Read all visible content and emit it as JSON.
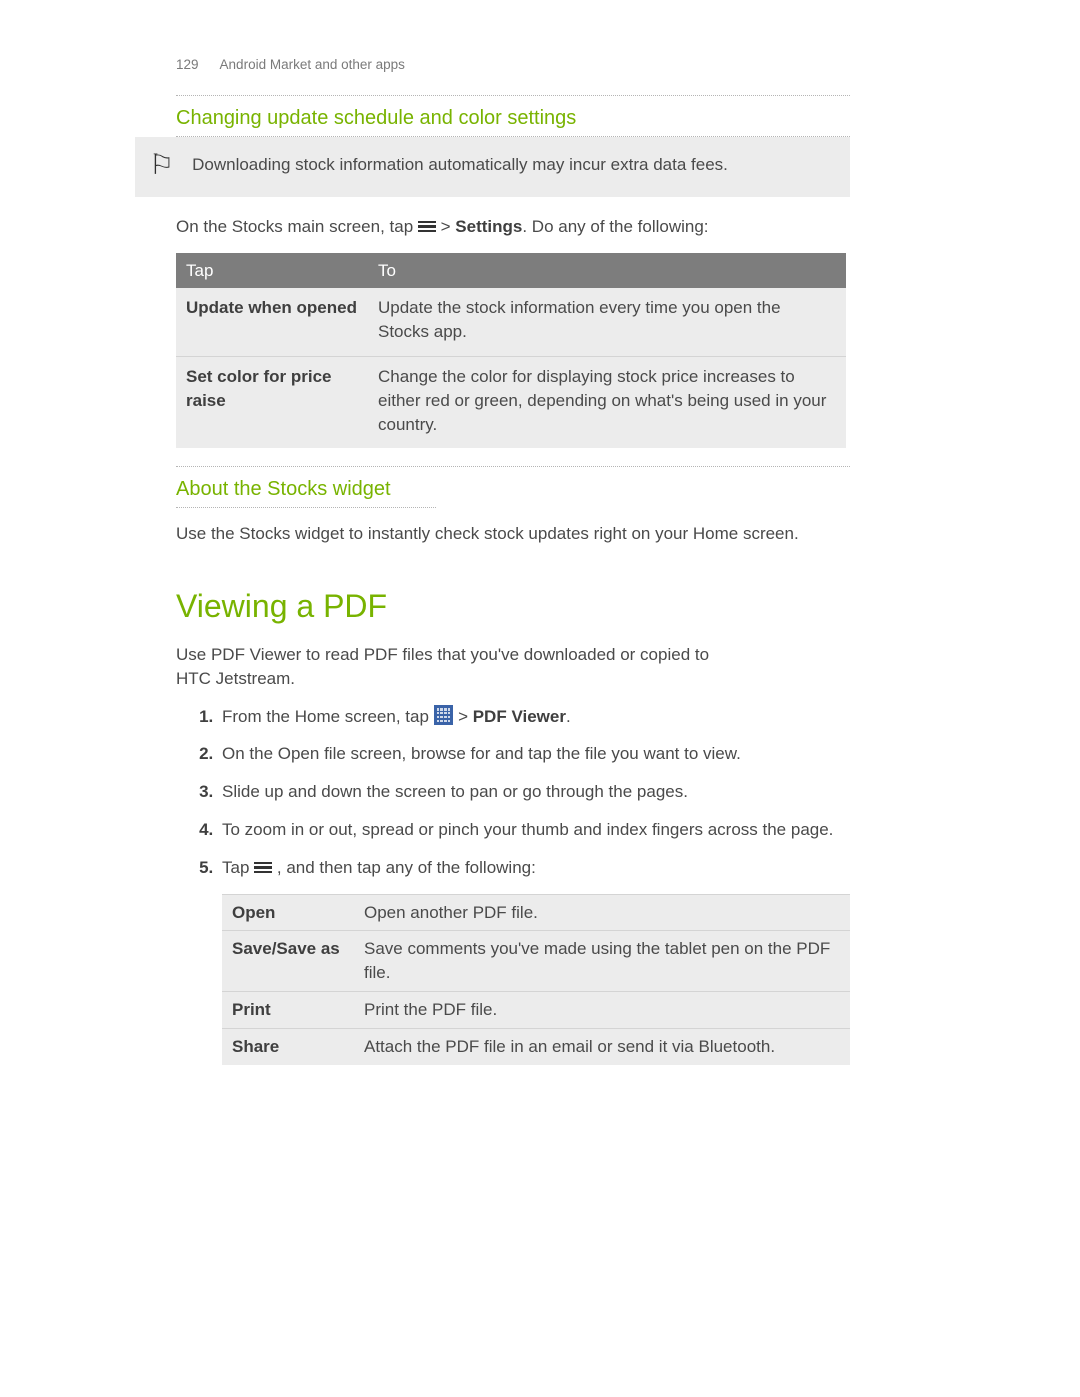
{
  "header": {
    "page_number": "129",
    "breadcrumb": "Android Market and other apps"
  },
  "section1": {
    "title": "Changing update schedule and color settings",
    "callout": "Downloading stock information automatically may incur extra data fees.",
    "intro_pre": "On the Stocks main screen, tap ",
    "intro_mid": " > ",
    "intro_bold": "Settings",
    "intro_post": ". Do any of the following:",
    "table": {
      "head": {
        "c1": "Tap",
        "c2": "To"
      },
      "rows": [
        {
          "c1": "Update when opened",
          "c2": "Update the stock information every time you open the Stocks app."
        },
        {
          "c1": "Set color for price raise",
          "c2": "Change the color for displaying stock price increases to either red or green, depending on what's being used in your country."
        }
      ]
    }
  },
  "section2": {
    "title": "About the Stocks widget",
    "para": "Use the Stocks widget to instantly check stock updates right on your Home screen."
  },
  "section3": {
    "title": "Viewing a PDF",
    "intro": "Use PDF Viewer to read PDF files that you've downloaded or copied to HTC Jetstream.",
    "steps": {
      "s1_pre": "From the Home screen, tap ",
      "s1_mid": " > ",
      "s1_bold": "PDF Viewer",
      "s1_post": ".",
      "s2": "On the Open file screen, browse for and tap the file you want to view.",
      "s3": "Slide up and down the screen to pan or go through the pages.",
      "s4": "To zoom in or out, spread or pinch your thumb and index fingers across the page.",
      "s5_pre": "Tap ",
      "s5_post": " , and then tap any of the following:"
    },
    "table": {
      "rows": [
        {
          "c1": "Open",
          "c2": "Open another PDF file."
        },
        {
          "c1": "Save/Save as",
          "c2": "Save comments you've made using the tablet pen on the PDF file."
        },
        {
          "c1": "Print",
          "c2": "Print the PDF file."
        },
        {
          "c1": "Share",
          "c2": "Attach the PDF file in an email or send it via Bluetooth."
        }
      ]
    }
  }
}
